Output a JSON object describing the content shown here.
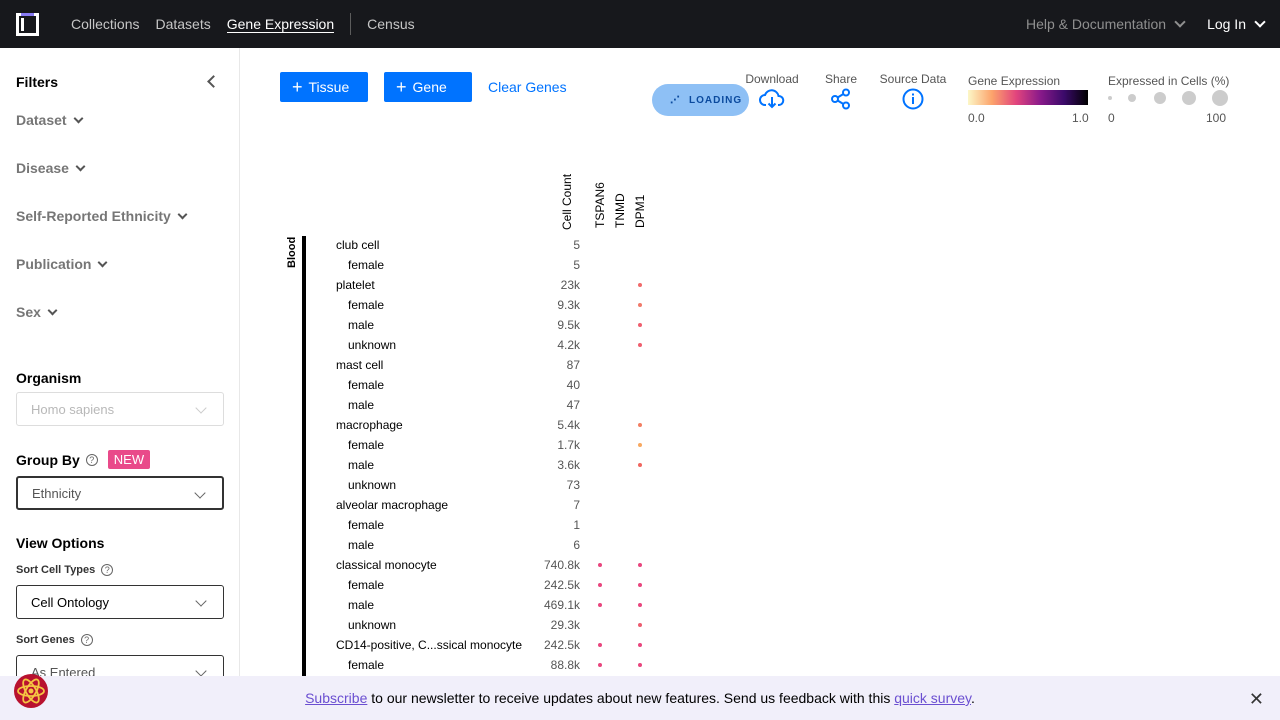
{
  "nav": {
    "links": [
      "Collections",
      "Datasets",
      "Gene Expression",
      "Census"
    ],
    "help": "Help & Documentation",
    "login": "Log In"
  },
  "sidebar": {
    "title": "Filters",
    "filters": [
      "Dataset",
      "Disease",
      "Self-Reported Ethnicity",
      "Publication",
      "Sex"
    ],
    "organism": {
      "label": "Organism",
      "value": "Homo sapiens"
    },
    "group_by": {
      "label": "Group By",
      "badge": "NEW",
      "value": "Ethnicity"
    },
    "view_options": {
      "label": "View Options",
      "sort_cell_types": {
        "label": "Sort Cell Types",
        "value": "Cell Ontology"
      },
      "sort_genes": {
        "label": "Sort Genes",
        "value": "As Entered"
      }
    }
  },
  "toolbar": {
    "tissue_button": "Tissue",
    "gene_button": "Gene",
    "clear_genes": "Clear Genes",
    "loading": "LOADING",
    "download": "Download",
    "share": "Share",
    "source_data": "Source Data",
    "gene_expression_legend": {
      "title": "Gene Expression",
      "min": "0.0",
      "max": "1.0"
    },
    "expressed_legend": {
      "title": "Expressed in Cells (%)",
      "min": "0",
      "max": "100"
    }
  },
  "dotplot": {
    "columns": [
      "Cell Count",
      "TSPAN6",
      "TNMD",
      "DPM1"
    ],
    "tissue": "Blood",
    "rows": [
      {
        "label": "club cell",
        "count": "5",
        "sub": false,
        "dots": []
      },
      {
        "label": "female",
        "count": "5",
        "sub": true,
        "dots": []
      },
      {
        "label": "platelet",
        "count": "23k",
        "sub": false,
        "dots": [
          [
            2,
            "#f06a6a"
          ]
        ]
      },
      {
        "label": "female",
        "count": "9.3k",
        "sub": true,
        "dots": [
          [
            2,
            "#f07a6a"
          ]
        ]
      },
      {
        "label": "male",
        "count": "9.5k",
        "sub": true,
        "dots": [
          [
            2,
            "#ef5f6e"
          ]
        ]
      },
      {
        "label": "unknown",
        "count": "4.2k",
        "sub": true,
        "dots": [
          [
            2,
            "#ef5f6e"
          ]
        ]
      },
      {
        "label": "mast cell",
        "count": "87",
        "sub": false,
        "dots": []
      },
      {
        "label": "female",
        "count": "40",
        "sub": true,
        "dots": []
      },
      {
        "label": "male",
        "count": "47",
        "sub": true,
        "dots": []
      },
      {
        "label": "macrophage",
        "count": "5.4k",
        "sub": false,
        "dots": [
          [
            2,
            "#f27e62"
          ]
        ]
      },
      {
        "label": "female",
        "count": "1.7k",
        "sub": true,
        "dots": [
          [
            2,
            "#f8a860"
          ]
        ]
      },
      {
        "label": "male",
        "count": "3.6k",
        "sub": true,
        "dots": [
          [
            2,
            "#f0665f"
          ]
        ]
      },
      {
        "label": "unknown",
        "count": "73",
        "sub": true,
        "dots": []
      },
      {
        "label": "alveolar macrophage",
        "count": "7",
        "sub": false,
        "dots": []
      },
      {
        "label": "female",
        "count": "1",
        "sub": true,
        "dots": []
      },
      {
        "label": "male",
        "count": "6",
        "sub": true,
        "dots": []
      },
      {
        "label": "classical monocyte",
        "count": "740.8k",
        "sub": false,
        "dots": [
          [
            0,
            "#e8467e"
          ],
          [
            2,
            "#e8467e"
          ]
        ]
      },
      {
        "label": "female",
        "count": "242.5k",
        "sub": true,
        "dots": [
          [
            0,
            "#e8467e"
          ],
          [
            2,
            "#e8467e"
          ]
        ]
      },
      {
        "label": "male",
        "count": "469.1k",
        "sub": true,
        "dots": [
          [
            0,
            "#e8467e"
          ],
          [
            2,
            "#e8467e"
          ]
        ]
      },
      {
        "label": "unknown",
        "count": "29.3k",
        "sub": true,
        "dots": [
          [
            2,
            "#ec5d6f"
          ]
        ]
      },
      {
        "label": "CD14-positive, C...ssical monocyte",
        "count": "242.5k",
        "sub": false,
        "dots": [
          [
            0,
            "#e8467e"
          ],
          [
            2,
            "#e8467e"
          ]
        ]
      },
      {
        "label": "female",
        "count": "88.8k",
        "sub": true,
        "dots": [
          [
            0,
            "#e8467e"
          ],
          [
            2,
            "#e8467e"
          ]
        ]
      }
    ]
  },
  "banner": {
    "subscribe": "Subscribe",
    "text": " to our newsletter to receive updates about new features. Send us feedback with this ",
    "survey": "quick survey",
    "end": "."
  }
}
